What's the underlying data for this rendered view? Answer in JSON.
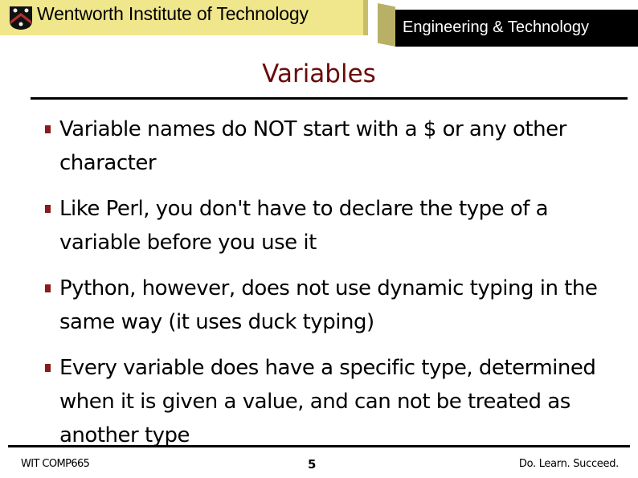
{
  "header": {
    "institution": "Wentworth Institute of Technology",
    "department": "Engineering & Technology",
    "logo_icon": "crest-shield-icon",
    "colors": {
      "banner_yellow": "#f0e68c",
      "banner_black": "#000000",
      "title_color": "#6b0a0a",
      "bullet_color": "#8b1a1a"
    }
  },
  "slide": {
    "title": "Variables",
    "bullets": [
      {
        "text": "Variable names do NOT start with a $ or any other character"
      },
      {
        "text": "Like Perl, you don't have to declare the type of a variable before you use it"
      },
      {
        "text": "Python, however, does not use dynamic typing in the same way (it uses duck typing)"
      },
      {
        "text": "Every variable does have a specific type, determined when it is given a value, and can not be treated as another type"
      }
    ]
  },
  "footer": {
    "course": "WIT COMP665",
    "page_number": "5",
    "motto": "Do. Learn. Succeed."
  }
}
